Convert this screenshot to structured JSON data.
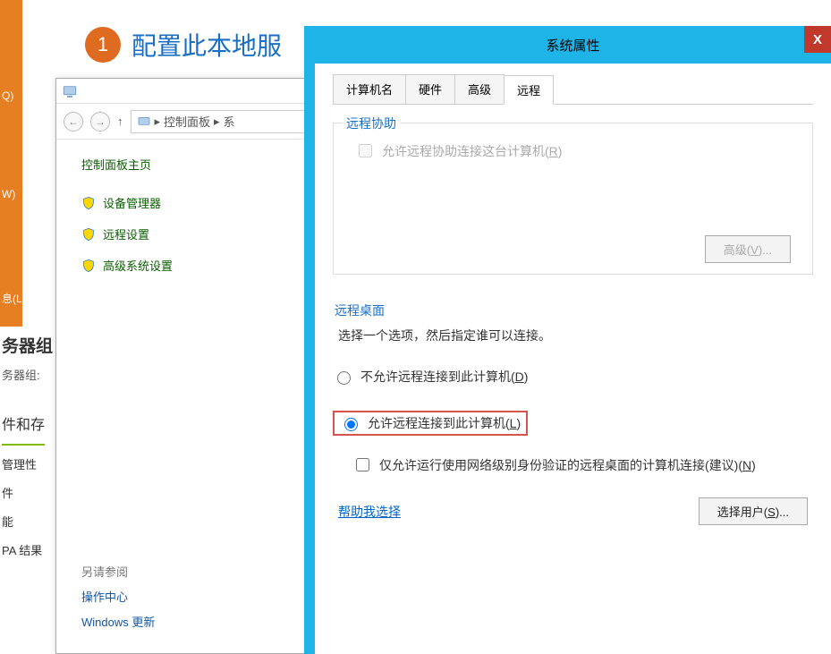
{
  "left_orange": {
    "q": "Q)",
    "w": "W)",
    "info": "息(L)"
  },
  "left_side": {
    "group1_title": "务器组",
    "group1_sub": "务器组: ",
    "item1": "件和存",
    "item2": "管理性",
    "item3": "件",
    "item4": "能",
    "item5": "PA 结果"
  },
  "header": {
    "number": "1",
    "title": "配置此本地服"
  },
  "cp": {
    "breadcrumb_root": "控制面板",
    "breadcrumb_sep": "▸",
    "breadcrumb_tail": "系",
    "title": "控制面板主页",
    "link1": "设备管理器",
    "link2": "远程设置",
    "link3": "高级系统设置",
    "related_title": "另请参阅",
    "related_link1": "操作中心",
    "related_link2": "Windows 更新"
  },
  "dialog": {
    "title": "系统属性",
    "close_x": "X",
    "tabs": {
      "t1": "计算机名",
      "t2": "硬件",
      "t3": "高级",
      "t4": "远程"
    },
    "group_assist_title": "远程协助",
    "chk_assist": "允许远程协助连接这台计算机(",
    "chk_assist_mn": "R",
    "btn_advanced": "高级(",
    "btn_advanced_mn": "V",
    "group_rdp_title": "远程桌面",
    "rdp_desc": "选择一个选项，然后指定谁可以连接。",
    "radio_deny": "不允许远程连接到此计算机(",
    "radio_deny_mn": "D",
    "radio_allow": "允许远程连接到此计算机(",
    "radio_allow_mn": "L",
    "chk_nla": "仅允许运行使用网络级别身份验证的远程桌面的计算机连接(建议)(",
    "chk_nla_mn": "N",
    "help_link": "帮助我选择",
    "btn_users": "选择用户(",
    "btn_users_mn": "S",
    "close_paren": ")",
    "ellipsis": "..."
  }
}
